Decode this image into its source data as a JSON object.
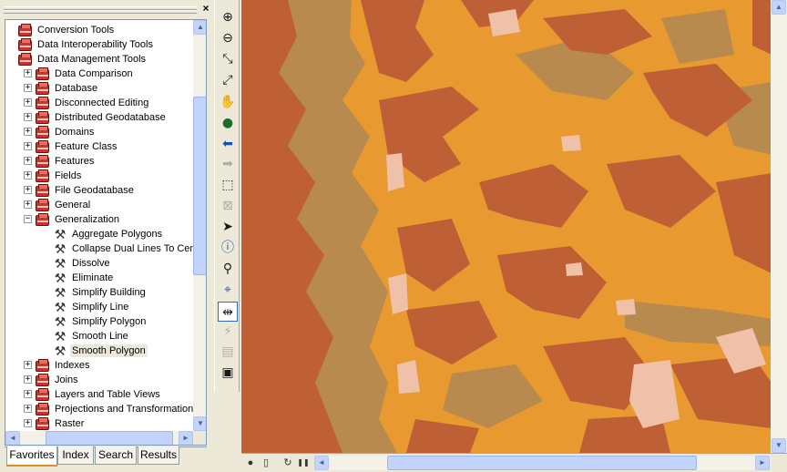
{
  "panel": {
    "close_glyph": "×"
  },
  "tree": {
    "items": [
      {
        "level": 0,
        "kind": "toolbox",
        "expander": "",
        "label": "Conversion Tools"
      },
      {
        "level": 0,
        "kind": "toolbox",
        "expander": "",
        "label": "Data Interoperability Tools"
      },
      {
        "level": 0,
        "kind": "toolbox",
        "expander": "",
        "label": "Data Management Tools"
      },
      {
        "level": 1,
        "kind": "toolset",
        "expander": "+",
        "label": "Data Comparison"
      },
      {
        "level": 1,
        "kind": "toolset",
        "expander": "+",
        "label": "Database"
      },
      {
        "level": 1,
        "kind": "toolset",
        "expander": "+",
        "label": "Disconnected Editing"
      },
      {
        "level": 1,
        "kind": "toolset",
        "expander": "+",
        "label": "Distributed Geodatabase"
      },
      {
        "level": 1,
        "kind": "toolset",
        "expander": "+",
        "label": "Domains"
      },
      {
        "level": 1,
        "kind": "toolset",
        "expander": "+",
        "label": "Feature Class"
      },
      {
        "level": 1,
        "kind": "toolset",
        "expander": "+",
        "label": "Features"
      },
      {
        "level": 1,
        "kind": "toolset",
        "expander": "+",
        "label": "Fields"
      },
      {
        "level": 1,
        "kind": "toolset",
        "expander": "+",
        "label": "File Geodatabase"
      },
      {
        "level": 1,
        "kind": "toolset",
        "expander": "+",
        "label": "General"
      },
      {
        "level": 1,
        "kind": "toolset",
        "expander": "−",
        "label": "Generalization"
      },
      {
        "level": 2,
        "kind": "tool",
        "expander": "",
        "label": "Aggregate Polygons"
      },
      {
        "level": 2,
        "kind": "tool",
        "expander": "",
        "label": "Collapse Dual Lines To Cent"
      },
      {
        "level": 2,
        "kind": "tool",
        "expander": "",
        "label": "Dissolve"
      },
      {
        "level": 2,
        "kind": "tool",
        "expander": "",
        "label": "Eliminate"
      },
      {
        "level": 2,
        "kind": "tool",
        "expander": "",
        "label": "Simplify Building"
      },
      {
        "level": 2,
        "kind": "tool",
        "expander": "",
        "label": "Simplify Line"
      },
      {
        "level": 2,
        "kind": "tool",
        "expander": "",
        "label": "Simplify Polygon"
      },
      {
        "level": 2,
        "kind": "tool",
        "expander": "",
        "label": "Smooth Line"
      },
      {
        "level": 2,
        "kind": "tool",
        "expander": "",
        "label": "Smooth Polygon",
        "selected": true
      },
      {
        "level": 1,
        "kind": "toolset",
        "expander": "+",
        "label": "Indexes"
      },
      {
        "level": 1,
        "kind": "toolset",
        "expander": "+",
        "label": "Joins"
      },
      {
        "level": 1,
        "kind": "toolset",
        "expander": "+",
        "label": "Layers and Table Views"
      },
      {
        "level": 1,
        "kind": "toolset",
        "expander": "+",
        "label": "Projections and Transformations"
      },
      {
        "level": 1,
        "kind": "toolset",
        "expander": "+",
        "label": "Raster"
      }
    ]
  },
  "scrollbars": {
    "up": "▲",
    "down": "▼",
    "left": "◄",
    "right": "►"
  },
  "tabs": [
    {
      "label": "Favorites",
      "active": true
    },
    {
      "label": "Index",
      "active": false
    },
    {
      "label": "Search",
      "active": false
    },
    {
      "label": "Results",
      "active": false
    }
  ],
  "tools_toolbar": [
    {
      "name": "zoom-in-icon",
      "glyph": "⊕",
      "state": "normal"
    },
    {
      "name": "zoom-out-icon",
      "glyph": "⊖",
      "state": "normal"
    },
    {
      "name": "fixed-zoom-in-icon",
      "glyph": "⤡",
      "state": "normal"
    },
    {
      "name": "fixed-zoom-out-icon",
      "glyph": "⤢",
      "state": "normal"
    },
    {
      "name": "pan-hand-icon",
      "glyph": "✋",
      "state": "normal"
    },
    {
      "name": "full-extent-globe-icon",
      "glyph": "●",
      "state": "normal"
    },
    {
      "name": "back-arrow-icon",
      "glyph": "⬅",
      "state": "normal"
    },
    {
      "name": "forward-arrow-icon",
      "glyph": "➡",
      "state": "disabled"
    },
    {
      "name": "select-features-icon",
      "glyph": "⬚",
      "state": "normal"
    },
    {
      "name": "clear-selection-icon",
      "glyph": "⊠",
      "state": "disabled"
    },
    {
      "name": "select-elements-pointer-icon",
      "glyph": "➤",
      "state": "normal"
    },
    {
      "name": "identify-info-icon",
      "glyph": "ⓘ",
      "state": "normal"
    },
    {
      "name": "find-binoculars-icon",
      "glyph": "⚲",
      "state": "normal"
    },
    {
      "name": "go-to-xy-icon",
      "glyph": "⌖",
      "state": "normal"
    },
    {
      "name": "measure-icon",
      "glyph": "⇹",
      "state": "pressed"
    },
    {
      "name": "hyperlink-lightning-icon",
      "glyph": "⚡",
      "state": "disabled"
    },
    {
      "name": "html-popup-icon",
      "glyph": "▤",
      "state": "disabled"
    },
    {
      "name": "time-slider-window-icon",
      "glyph": "▣",
      "state": "normal"
    }
  ],
  "map": {
    "colors": {
      "base": "#e8992f",
      "dark": "#bf5f35",
      "tan": "#b88a4e",
      "pink": "#eec1a8"
    }
  },
  "status_bar": {
    "icons": [
      {
        "name": "data-view-globe-icon",
        "glyph": "●"
      },
      {
        "name": "layout-view-page-icon",
        "glyph": "▯"
      },
      {
        "name": "refresh-icon",
        "glyph": "↻"
      },
      {
        "name": "pause-drawing-icon",
        "glyph": "❚❚"
      }
    ]
  }
}
